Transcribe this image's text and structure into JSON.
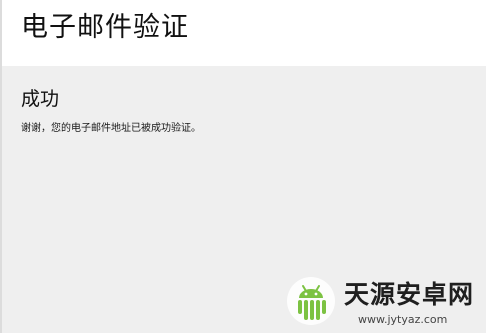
{
  "header": {
    "title": "电子邮件验证"
  },
  "content": {
    "heading": "成功",
    "message": "谢谢，您的电子邮件地址已被成功验证。"
  },
  "watermark": {
    "name": "天源安卓网",
    "url": "www.jytyaz.com",
    "logo_icon": "android-logo-icon",
    "logo_color": "#7cc242"
  },
  "colors": {
    "header_bg": "#ffffff",
    "content_bg": "#efefef",
    "text": "#111111"
  }
}
